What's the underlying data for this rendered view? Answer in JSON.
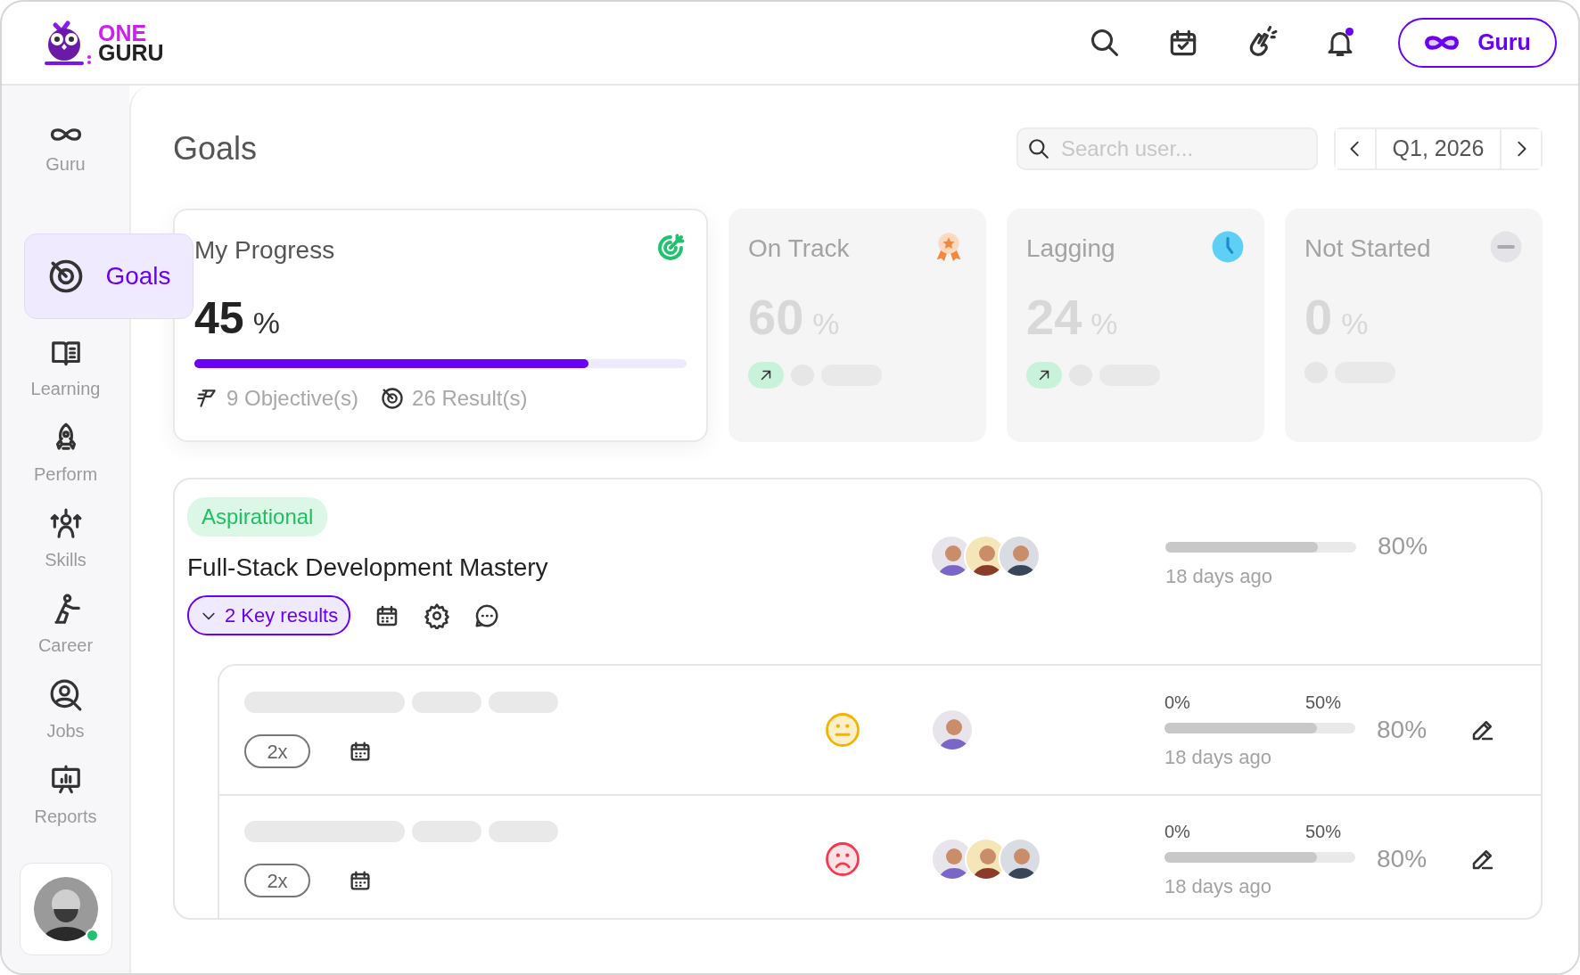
{
  "logo": {
    "line1": "ONE",
    "line2": "GURU"
  },
  "header": {
    "guru_button": "Guru",
    "unread_notifications": true
  },
  "sidebar": {
    "top": {
      "label": "Guru"
    },
    "items": [
      {
        "label": "Goals",
        "selected": true
      },
      {
        "label": "Learning",
        "selected": false
      },
      {
        "label": "Perform",
        "selected": false
      },
      {
        "label": "Skills",
        "selected": false
      },
      {
        "label": "Career",
        "selected": false
      },
      {
        "label": "Jobs",
        "selected": false
      },
      {
        "label": "Reports",
        "selected": false
      }
    ],
    "user": {
      "online": true
    }
  },
  "page": {
    "title": "Goals",
    "search": {
      "placeholder": "Search user..."
    },
    "period": "Q1, 2026"
  },
  "stats": [
    {
      "kind": "main",
      "title": "My Progress",
      "value": "45",
      "unit": "%",
      "level": 0.8,
      "objectives": "9 Objective(s)",
      "results": "26 Result(s)"
    },
    {
      "kind": "summary",
      "title": "On Track",
      "value": "60",
      "unit": "%",
      "trend_up": true
    },
    {
      "kind": "summary",
      "title": "Lagging",
      "value": "24",
      "unit": "%",
      "trend_up": true
    },
    {
      "kind": "summary",
      "title": "Not Started",
      "value": "0",
      "unit": "%",
      "trend_up": false
    }
  ],
  "goal": {
    "tag": "Aspirational",
    "title": "Full-Stack Development Mastery",
    "key_results_button": "2 Key results",
    "expanded": true,
    "owners": [
      {
        "kind": "picture"
      },
      {
        "kind": "picture"
      },
      {
        "kind": "picture"
      }
    ],
    "level": 0.8,
    "percent": "80%",
    "updated": "18 days ago",
    "key_results": [
      {
        "kind": "neutral",
        "multiplier": "2x",
        "owners": [
          {
            "kind": "picture"
          }
        ],
        "scale_start": "0%",
        "scale_mid": "50%",
        "level": 0.8,
        "percent": "80%",
        "updated": "18 days ago"
      },
      {
        "kind": "sad",
        "multiplier": "2x",
        "owners": [
          {
            "kind": "picture"
          },
          {
            "kind": "picture"
          },
          {
            "kind": "picture"
          }
        ],
        "scale_start": "0%",
        "scale_mid": "50%",
        "level": 0.8,
        "percent": "80%",
        "updated": "18 days ago"
      }
    ]
  }
}
